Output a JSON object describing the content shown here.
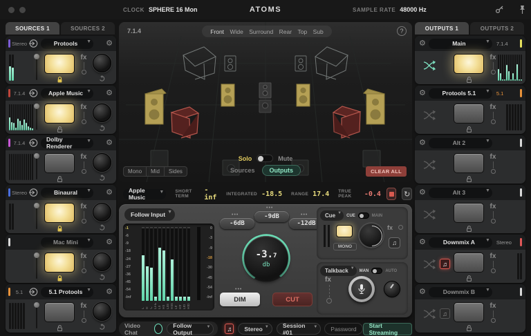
{
  "window": {
    "clock_label": "CLOCK",
    "clock_value": "SPHERE 16 Mon",
    "title": "ATOMS",
    "sample_rate_label": "SAMPLE RATE",
    "sample_rate_value": "48000 Hz"
  },
  "sources": {
    "tabs": [
      "SOURCES 1",
      "SOURCES 2"
    ],
    "active_tab": "SOURCES 1",
    "fx_label": "fx",
    "items": [
      {
        "name": "Protools",
        "format": "Stereo",
        "accent": "#7c5cd6",
        "active": true,
        "locked": true,
        "dim": false,
        "input_icon": true,
        "meter_color": "teal",
        "meters": [
          0.55,
          0.5
        ]
      },
      {
        "name": "Apple Music",
        "format": "7.1.4",
        "accent": "#c0453a",
        "active": true,
        "locked": false,
        "dim": false,
        "input_icon": true,
        "meter_color": "teal",
        "meters": [
          0.5,
          0.32,
          0.28,
          0.1,
          0.44,
          0.38,
          0.2,
          0.42,
          0.28,
          0.16,
          0.1,
          0.08
        ]
      },
      {
        "name": "Dolby Renderer",
        "format": "7.1.4",
        "accent": "#c957d6",
        "active": false,
        "locked": false,
        "dim": false,
        "input_icon": true,
        "meter_color": "dark",
        "meters": [
          0,
          0,
          0,
          0,
          0,
          0,
          0,
          0,
          0,
          0,
          0,
          0
        ]
      },
      {
        "name": "Binaural",
        "format": "Stereo",
        "accent": "#4a6fe0",
        "active": true,
        "locked": true,
        "dim": false,
        "input_icon": true,
        "meter_color": "dark",
        "meters": [
          0,
          0
        ]
      },
      {
        "name": "Mac Mini",
        "format": "",
        "accent": "#d9d9d9",
        "active": true,
        "locked": true,
        "dim": true,
        "input_icon": false,
        "meter_color": "dark",
        "meters": []
      },
      {
        "name": "5.1 Protools",
        "format": "5.1",
        "accent": "#e8923a",
        "active": false,
        "locked": false,
        "dim": false,
        "input_icon": true,
        "meter_color": "dark",
        "meters": [
          0,
          0,
          0,
          0,
          0,
          0
        ]
      }
    ]
  },
  "outputs": {
    "tabs": [
      "OUTPUTS 1",
      "OUTPUTS 2"
    ],
    "active_tab": "OUTPUTS 1",
    "fx_label": "fx",
    "items": [
      {
        "name": "Main",
        "format": "7.1.4",
        "format_color": "#9a9a9a",
        "accent": "#e6e15e",
        "active": true,
        "dim": false,
        "note": "none",
        "meter_color": "teal",
        "meters": [
          0.45,
          0.3,
          0.05,
          0.05,
          0.6,
          0.38,
          0.05,
          0.3,
          0.05,
          0.62,
          0.05,
          0.05
        ]
      },
      {
        "name": "Protools 5.1",
        "format": "5.1",
        "format_color": "#e8923a",
        "accent": "#e8923a",
        "active": false,
        "dim": false,
        "note": "none",
        "meter_color": "dark",
        "meters": [
          0,
          0,
          0,
          0,
          0,
          0
        ]
      },
      {
        "name": "Alt 2",
        "format": "",
        "format_color": "#9a9a9a",
        "accent": "#d9d9d9",
        "active": false,
        "dim": true,
        "note": "none",
        "meter_color": "dark",
        "meters": []
      },
      {
        "name": "Alt 3",
        "format": "",
        "format_color": "#9a9a9a",
        "accent": "#d9d9d9",
        "active": false,
        "dim": true,
        "note": "none",
        "meter_color": "dark",
        "meters": []
      },
      {
        "name": "Downmix A",
        "format": "Stereo",
        "format_color": "#9a9a9a",
        "accent": "#e05858",
        "active": false,
        "dim": false,
        "note": "red",
        "meter_color": "dark",
        "meters": [
          0,
          0
        ]
      },
      {
        "name": "Downmix B",
        "format": "",
        "format_color": "#9a9a9a",
        "accent": "#d9d9d9",
        "active": false,
        "dim": true,
        "note": "gray",
        "meter_color": "dark",
        "meters": []
      }
    ]
  },
  "viz": {
    "format_label": "7.1.4",
    "views": [
      "Front",
      "Wide",
      "Surround",
      "Rear",
      "Top",
      "Sub"
    ],
    "help": "?",
    "solo_label": "Solo",
    "mute_label": "Mute",
    "ms_buttons": [
      "Mono",
      "Mid",
      "Sides"
    ],
    "layer_toggle": {
      "sources": "Sources",
      "outputs": "Outputs",
      "active": "Outputs"
    },
    "clear_all": "CLEAR ALL"
  },
  "loudness": {
    "source": "Apple Music",
    "short_term_label": "SHORT TERM",
    "short_term": "-inf",
    "integrated_label": "INTEGRATED",
    "integrated": "-18.5",
    "range_label": "RANGE",
    "range": "17.4",
    "true_peak_label": "TRUE PEAK",
    "true_peak": "-0.4"
  },
  "monitor": {
    "input_select": "Follow Input",
    "fx_label": "fx",
    "meter": {
      "left_scale": [
        "-1",
        "-6",
        "-9",
        "-18",
        "-24",
        "-27",
        "-36",
        "-45",
        "-54",
        "-Inf"
      ],
      "right_scale": [
        "0",
        "-3",
        "-9",
        "-18",
        "-30",
        "-45",
        "-54",
        "-Inf"
      ],
      "right_highlight": "-18",
      "channels": [
        "L",
        "R",
        "C",
        "LFE",
        "Ls",
        "Rs",
        "Lss",
        "Rss",
        "Ltf",
        "Rtf",
        "Ltb",
        "Rtb"
      ],
      "values": [
        0.62,
        0.47,
        0.45,
        0.06,
        0.72,
        0.68,
        0.06,
        0.56,
        0.06,
        0.06,
        0.06,
        0.06
      ]
    },
    "trim_buttons": [
      "-6dB",
      "-9dB",
      "-12dB"
    ],
    "level_main": "-3.",
    "level_frac": "7",
    "level_unit": "db",
    "dim": "DIM",
    "cut": "CUT",
    "cue": {
      "select": "Cue",
      "left": "CUE",
      "right": "MAIN",
      "mono": "MONO"
    },
    "talkback": {
      "select": "Talkback",
      "left": "MAN",
      "right": "AUTO"
    }
  },
  "stream": {
    "video_chat": "Video Chat",
    "output_select": "Follow Output",
    "format_select": "Stereo",
    "session": "Session #01",
    "password_placeholder": "Password",
    "start": "Start Streaming"
  },
  "colors": {
    "teal": "#7fe3c3",
    "pad_yellow": "#f4e09a",
    "alert_red": "#d85a50",
    "solo_yellow": "#e0ca5e"
  }
}
